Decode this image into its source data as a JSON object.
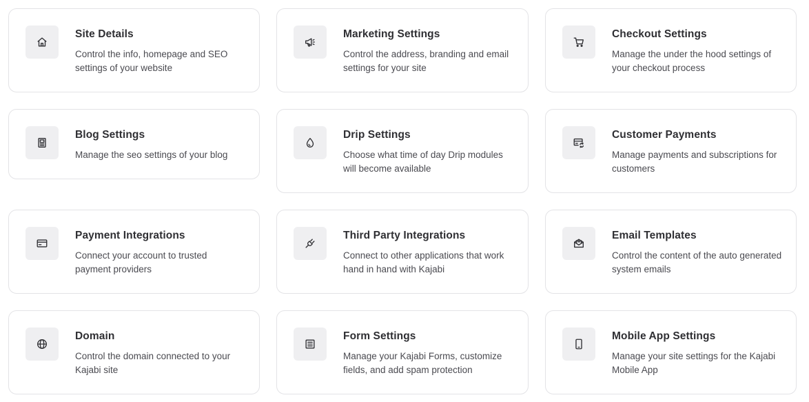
{
  "cards": [
    {
      "title": "Site Details",
      "description": "Control the info, homepage and SEO settings of your website",
      "icon": "home-icon"
    },
    {
      "title": "Marketing Settings",
      "description": "Control the address, branding and email settings for your site",
      "icon": "megaphone-icon"
    },
    {
      "title": "Checkout Settings",
      "description": "Manage the under the hood settings of your checkout process",
      "icon": "cart-icon"
    },
    {
      "title": "Blog Settings",
      "description": "Manage the seo settings of your blog",
      "icon": "blog-icon"
    },
    {
      "title": "Drip Settings",
      "description": "Choose what time of day Drip modules will become available",
      "icon": "drop-icon"
    },
    {
      "title": "Customer Payments",
      "description": "Manage payments and subscriptions for customers",
      "icon": "payment-refresh-icon"
    },
    {
      "title": "Payment Integrations",
      "description": "Connect your account to trusted payment providers",
      "icon": "credit-card-icon"
    },
    {
      "title": "Third Party Integrations",
      "description": "Connect to other applications that work hand in hand with Kajabi",
      "icon": "plug-icon"
    },
    {
      "title": "Email Templates",
      "description": "Control the content of the auto generated system emails",
      "icon": "envelope-open-icon"
    },
    {
      "title": "Domain",
      "description": "Control the domain connected to your Kajabi site",
      "icon": "globe-icon"
    },
    {
      "title": "Form Settings",
      "description": "Manage your Kajabi Forms, customize fields, and add spam protection",
      "icon": "form-icon"
    },
    {
      "title": "Mobile App Settings",
      "description": "Manage your site settings for the Kajabi Mobile App",
      "icon": "mobile-icon"
    }
  ]
}
